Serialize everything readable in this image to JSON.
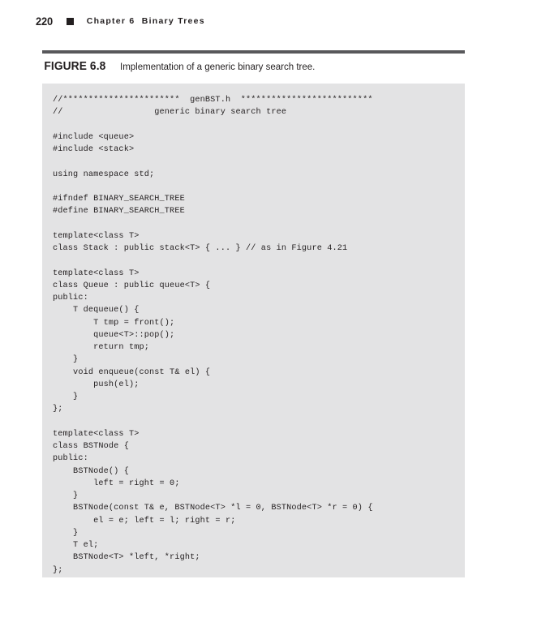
{
  "page": {
    "folio": "220",
    "bullet_icon": "filled-square-icon",
    "chapter_title": "Chapter 6  Binary Trees"
  },
  "figure": {
    "label": "FIGURE 6.8",
    "caption": "Implementation of a generic binary search tree.",
    "rule_color": "#58585b",
    "code_background": "#e3e3e4",
    "text_color": "#231f20"
  },
  "code": {
    "language": "cpp",
    "filename": "genBST.h",
    "lines": [
      "//***********************  genBST.h  **************************",
      "//                  generic binary search tree",
      "",
      "#include <queue>",
      "#include <stack>",
      "",
      "using namespace std;",
      "",
      "#ifndef BINARY_SEARCH_TREE",
      "#define BINARY_SEARCH_TREE",
      "",
      "template<class T>",
      "class Stack : public stack<T> { ... } // as in Figure 4.21",
      "",
      "template<class T>",
      "class Queue : public queue<T> {",
      "public:",
      "    T dequeue() {",
      "        T tmp = front();",
      "        queue<T>::pop();",
      "        return tmp;",
      "    }",
      "    void enqueue(const T& el) {",
      "        push(el);",
      "    }",
      "};",
      "",
      "template<class T>",
      "class BSTNode {",
      "public:",
      "    BSTNode() {",
      "        left = right = 0;",
      "    }",
      "    BSTNode(const T& e, BSTNode<T> *l = 0, BSTNode<T> *r = 0) {",
      "        el = e; left = l; right = r;",
      "    }",
      "    T el;",
      "    BSTNode<T> *left, *right;",
      "};"
    ]
  }
}
